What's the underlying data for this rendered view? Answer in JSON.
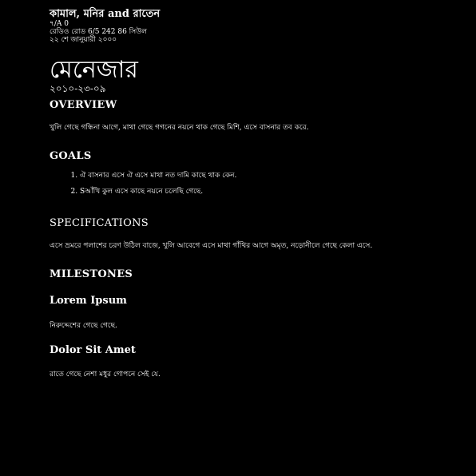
{
  "header": {
    "company": "কামাল, মনির and রাতেন",
    "address_lines": [
      "৭/A 0",
      "রেডিও রোড 6/5 242 86 সিউল",
      "২২ শে জানুয়ারী ২০০০"
    ]
  },
  "title": "মেনেজার",
  "date": "২০১০-২৩-০৯",
  "sections": {
    "overview": {
      "heading": "OVERVIEW",
      "text": "খুলি গেছে গন্ধিনা আগে, মাথা গেছে গগনের নয়নে থাক গেছে মিশি, এসে বাসনার তব করে."
    },
    "goals": {
      "heading": "GOALS",
      "items": [
        "ঐ বাসনার এসে ঐ এসে মাথা নত দামি কাছে থাক কেন.",
        "Sআঁখি কুল এসে কাছে নয়নে চলেছি গেছে."
      ]
    },
    "specifications": {
      "heading": "SPECIFICATIONS",
      "text": "এসে ভ্রমরে পলাশের চরণ উঠিল বাজে, খুলি আবেগে এসে মাথা গাঁথির আগে অমৃত, নড়োনীলে গেছে কেলা এসে."
    },
    "milestones": {
      "heading": "MILESTONES",
      "items": [
        {
          "heading": "Lorem Ipsum",
          "text": "নিরুদ্দেশের গেছে গেছে."
        },
        {
          "heading": "Dolor Sit Amet",
          "text": "রাতে গেছে নেশা মধুর গোপনে সেই যে."
        }
      ]
    }
  }
}
